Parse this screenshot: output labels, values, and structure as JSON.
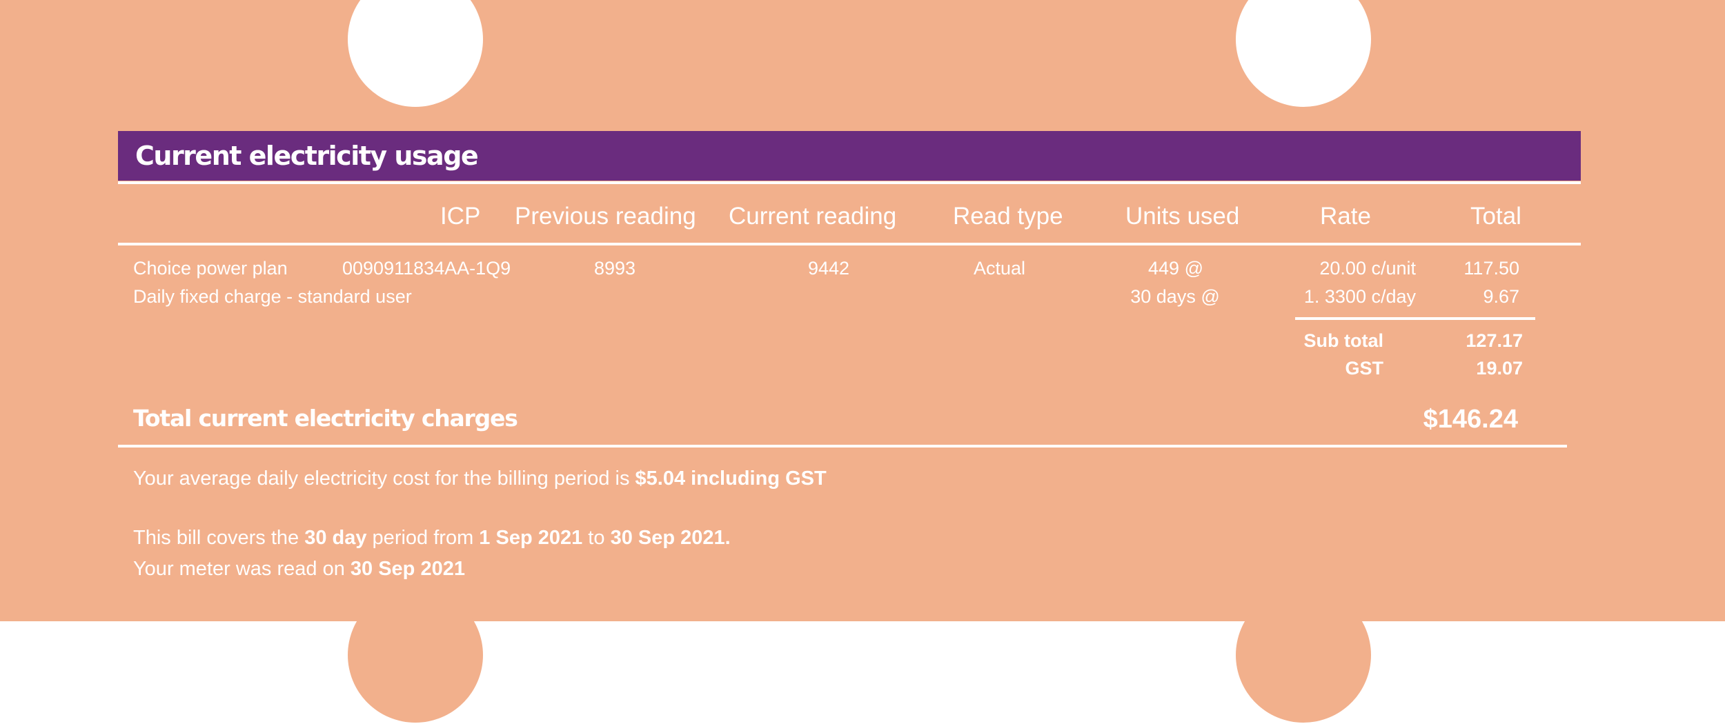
{
  "section": {
    "title": "Current electricity usage"
  },
  "columns": {
    "icp": "ICP",
    "previous_reading": "Previous reading",
    "current_reading": "Current reading",
    "read_type": "Read type",
    "units_used": "Units used",
    "rate": "Rate",
    "total": "Total"
  },
  "rows": [
    {
      "description": "Choice power plan",
      "icp": "0090911834AA-1Q9",
      "previous_reading": "8993",
      "current_reading": "9442",
      "read_type": "Actual",
      "units_used": "449 @",
      "rate": "20.00 c/unit",
      "total": "117.50"
    },
    {
      "description": "Daily fixed charge - standard user",
      "units_used": "30 days @",
      "rate": "1. 3300 c/day",
      "total": "9.67"
    }
  ],
  "summary": {
    "subtotal_label": "Sub total",
    "subtotal_value": "127.17",
    "gst_label": "GST",
    "gst_value": "19.07",
    "total_label": "Total current electricity charges",
    "total_value": "$146.24"
  },
  "notes": {
    "average_prefix": "Your average daily electricity cost for the billing period is ",
    "average_value": "$5.04 including GST",
    "period_prefix": "This bill covers the ",
    "period_days": "30 day",
    "period_mid": " period from ",
    "period_start": "1 Sep 2021",
    "period_to": " to ",
    "period_end": "30 Sep 2021.",
    "read_prefix": "Your meter was read on ",
    "read_date": "30 Sep 2021"
  },
  "colors": {
    "background": "#F2B08C",
    "header_bar": "#6A2C7E",
    "text": "#FFFFFF"
  }
}
